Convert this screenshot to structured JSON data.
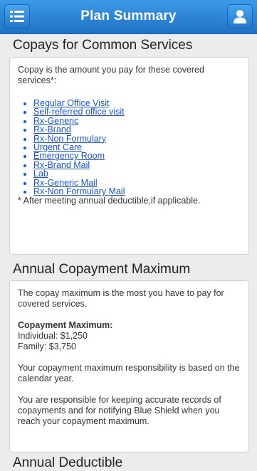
{
  "header": {
    "title": "Plan Summary",
    "menu_icon": "menu-icon",
    "user_icon": "user-icon",
    "bar_color": "#2a84d6"
  },
  "copays": {
    "title": "Copays for Common Services",
    "intro": "Copay is the amount you pay for these covered services*:",
    "links": [
      "Regular Office Visit",
      "Self-referred office visit",
      "Rx-Generic",
      "Rx-Brand",
      "Rx-Non Formulary",
      "Urgent Care",
      "Emergency Room",
      "Rx-Brand Mail",
      "Lab",
      "Rx-Generic Mail",
      "Rx-Non Formulary Mail"
    ],
    "footnote": "* After meeting annual deductible,if applicable."
  },
  "copay_max": {
    "title": "Annual Copayment Maximum",
    "intro": "The copay maximum is the most you have to pay for covered services.",
    "label": "Copayment Maximum:",
    "individual": "Individual: $1,250",
    "family": "Family: $3,750",
    "note1": "Your copayment maximum responsibility is based on the calendar year.",
    "note2": "You are responsible for keeping accurate records of copayments and for notifying Blue Shield when you reach your copayment maximum."
  },
  "deductible": {
    "title": "Annual Deductible"
  }
}
